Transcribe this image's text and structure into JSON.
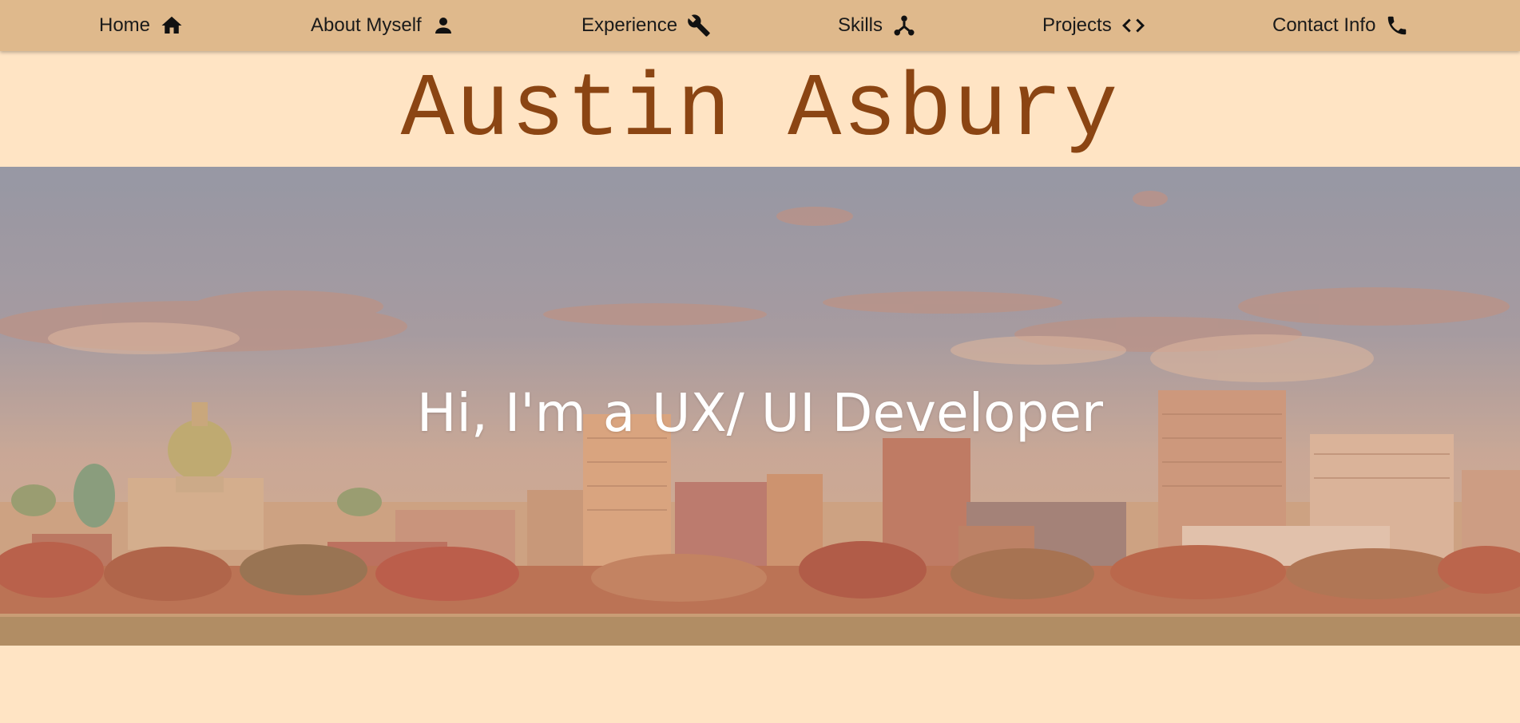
{
  "nav": {
    "items": [
      {
        "label": "Home",
        "icon": "home-icon"
      },
      {
        "label": "About Myself",
        "icon": "person-icon"
      },
      {
        "label": "Experience",
        "icon": "wrench-icon"
      },
      {
        "label": "Skills",
        "icon": "nodes-icon"
      },
      {
        "label": "Projects",
        "icon": "code-icon"
      },
      {
        "label": "Contact Info",
        "icon": "phone-icon"
      }
    ]
  },
  "header": {
    "name": "Austin Asbury"
  },
  "hero": {
    "headline": "Hi, I'm a UX/ UI Developer",
    "image": "city-skyline-image"
  },
  "colors": {
    "nav_background": "#dfb98c",
    "page_background": "#ffe4c4",
    "name_color": "#8b4513",
    "headline_color": "#ffffff"
  }
}
